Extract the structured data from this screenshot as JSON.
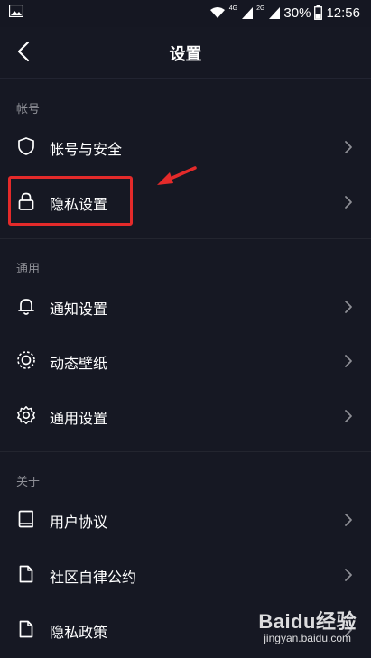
{
  "status_bar": {
    "net_a": "4G",
    "net_b": "2G",
    "battery": "30%",
    "time": "12:56"
  },
  "header": {
    "title": "设置"
  },
  "sections": [
    {
      "title": "帐号",
      "items": [
        {
          "label": "帐号与安全",
          "icon": "shield-icon"
        },
        {
          "label": "隐私设置",
          "icon": "lock-icon"
        }
      ]
    },
    {
      "title": "通用",
      "items": [
        {
          "label": "通知设置",
          "icon": "bell-icon"
        },
        {
          "label": "动态壁纸",
          "icon": "dynamic-wallpaper-icon"
        },
        {
          "label": "通用设置",
          "icon": "gear-icon"
        }
      ]
    },
    {
      "title": "关于",
      "items": [
        {
          "label": "用户协议",
          "icon": "book-icon"
        },
        {
          "label": "社区自律公约",
          "icon": "document-icon"
        },
        {
          "label": "隐私政策",
          "icon": "document-icon"
        }
      ]
    }
  ],
  "watermark": {
    "logo": "Baidu经验",
    "url": "jingyan.baidu.com"
  },
  "colors": {
    "background": "#161823",
    "highlight": "#e42a2a",
    "muted_text": "#8e8f96"
  }
}
